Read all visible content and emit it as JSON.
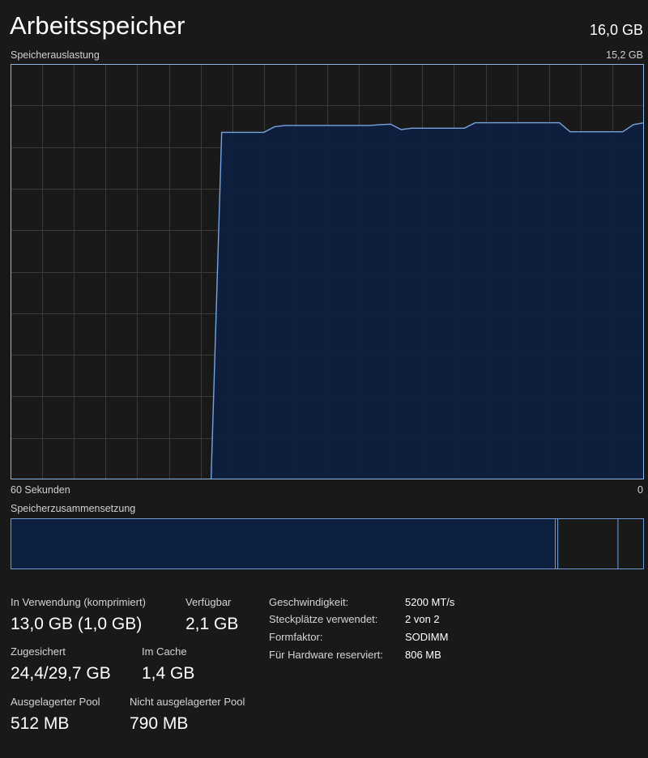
{
  "header": {
    "title": "Arbeitsspeicher",
    "total": "16,0 GB"
  },
  "usage_graph": {
    "label": "Speicherauslastung",
    "max_label": "15,2 GB",
    "left_axis": "60 Sekunden",
    "right_axis": "0"
  },
  "chart_data": {
    "type": "area",
    "x": [
      60,
      59,
      58,
      57,
      56,
      55,
      54,
      53,
      52,
      51,
      50,
      49,
      48,
      47,
      46,
      45,
      44,
      43,
      42,
      41,
      40,
      39,
      38,
      37,
      36,
      35,
      34,
      33,
      32,
      31,
      30,
      29,
      28,
      27,
      26,
      25,
      24,
      23,
      22,
      21,
      20,
      19,
      18,
      17,
      16,
      15,
      14,
      13,
      12,
      11,
      10,
      9,
      8,
      7,
      6,
      5,
      4,
      3,
      2,
      1,
      0
    ],
    "series": [
      {
        "values": [
          null,
          null,
          null,
          null,
          null,
          null,
          null,
          null,
          null,
          null,
          null,
          null,
          null,
          null,
          null,
          null,
          null,
          null,
          null,
          0,
          12.7,
          12.7,
          12.7,
          12.7,
          12.7,
          12.9,
          12.95,
          12.95,
          12.95,
          12.95,
          12.95,
          12.95,
          12.95,
          12.95,
          12.95,
          12.98,
          13.0,
          12.8,
          12.85,
          12.85,
          12.85,
          12.85,
          12.85,
          12.85,
          13.05,
          13.05,
          13.05,
          13.05,
          13.05,
          13.05,
          13.05,
          13.05,
          13.05,
          12.72,
          12.72,
          12.72,
          12.72,
          12.72,
          12.72,
          12.98,
          13.05
        ]
      }
    ],
    "ylim": [
      0,
      15.2
    ],
    "xlim": [
      60,
      0
    ],
    "grid": true,
    "colors": {
      "line": "#76a3e0",
      "fill": "#0e2040",
      "grid": "#3a3a3a",
      "border": "#8fb4e8"
    }
  },
  "composition": {
    "label": "Speicherzusammensetzung",
    "in_use_fraction": 0.86,
    "modified_fraction": 0.004,
    "standby_fraction": 0.095
  },
  "stats": {
    "in_use_label": "In Verwendung (komprimiert)",
    "in_use_value": "13,0 GB (1,0 GB)",
    "available_label": "Verfügbar",
    "available_value": "2,1 GB",
    "committed_label": "Zugesichert",
    "committed_value": "24,4/29,7 GB",
    "cached_label": "Im Cache",
    "cached_value": "1,4 GB",
    "paged_label": "Ausgelagerter Pool",
    "paged_value": "512 MB",
    "nonpaged_label": "Nicht ausgelagerter Pool",
    "nonpaged_value": "790 MB"
  },
  "properties": {
    "speed_label": "Geschwindigkeit:",
    "speed_value": "5200 MT/s",
    "slots_label": "Steckplätze verwendet:",
    "slots_value": "2 von 2",
    "form_label": "Formfaktor:",
    "form_value": "SODIMM",
    "reserved_label": "Für Hardware reserviert:",
    "reserved_value": "806 MB"
  }
}
